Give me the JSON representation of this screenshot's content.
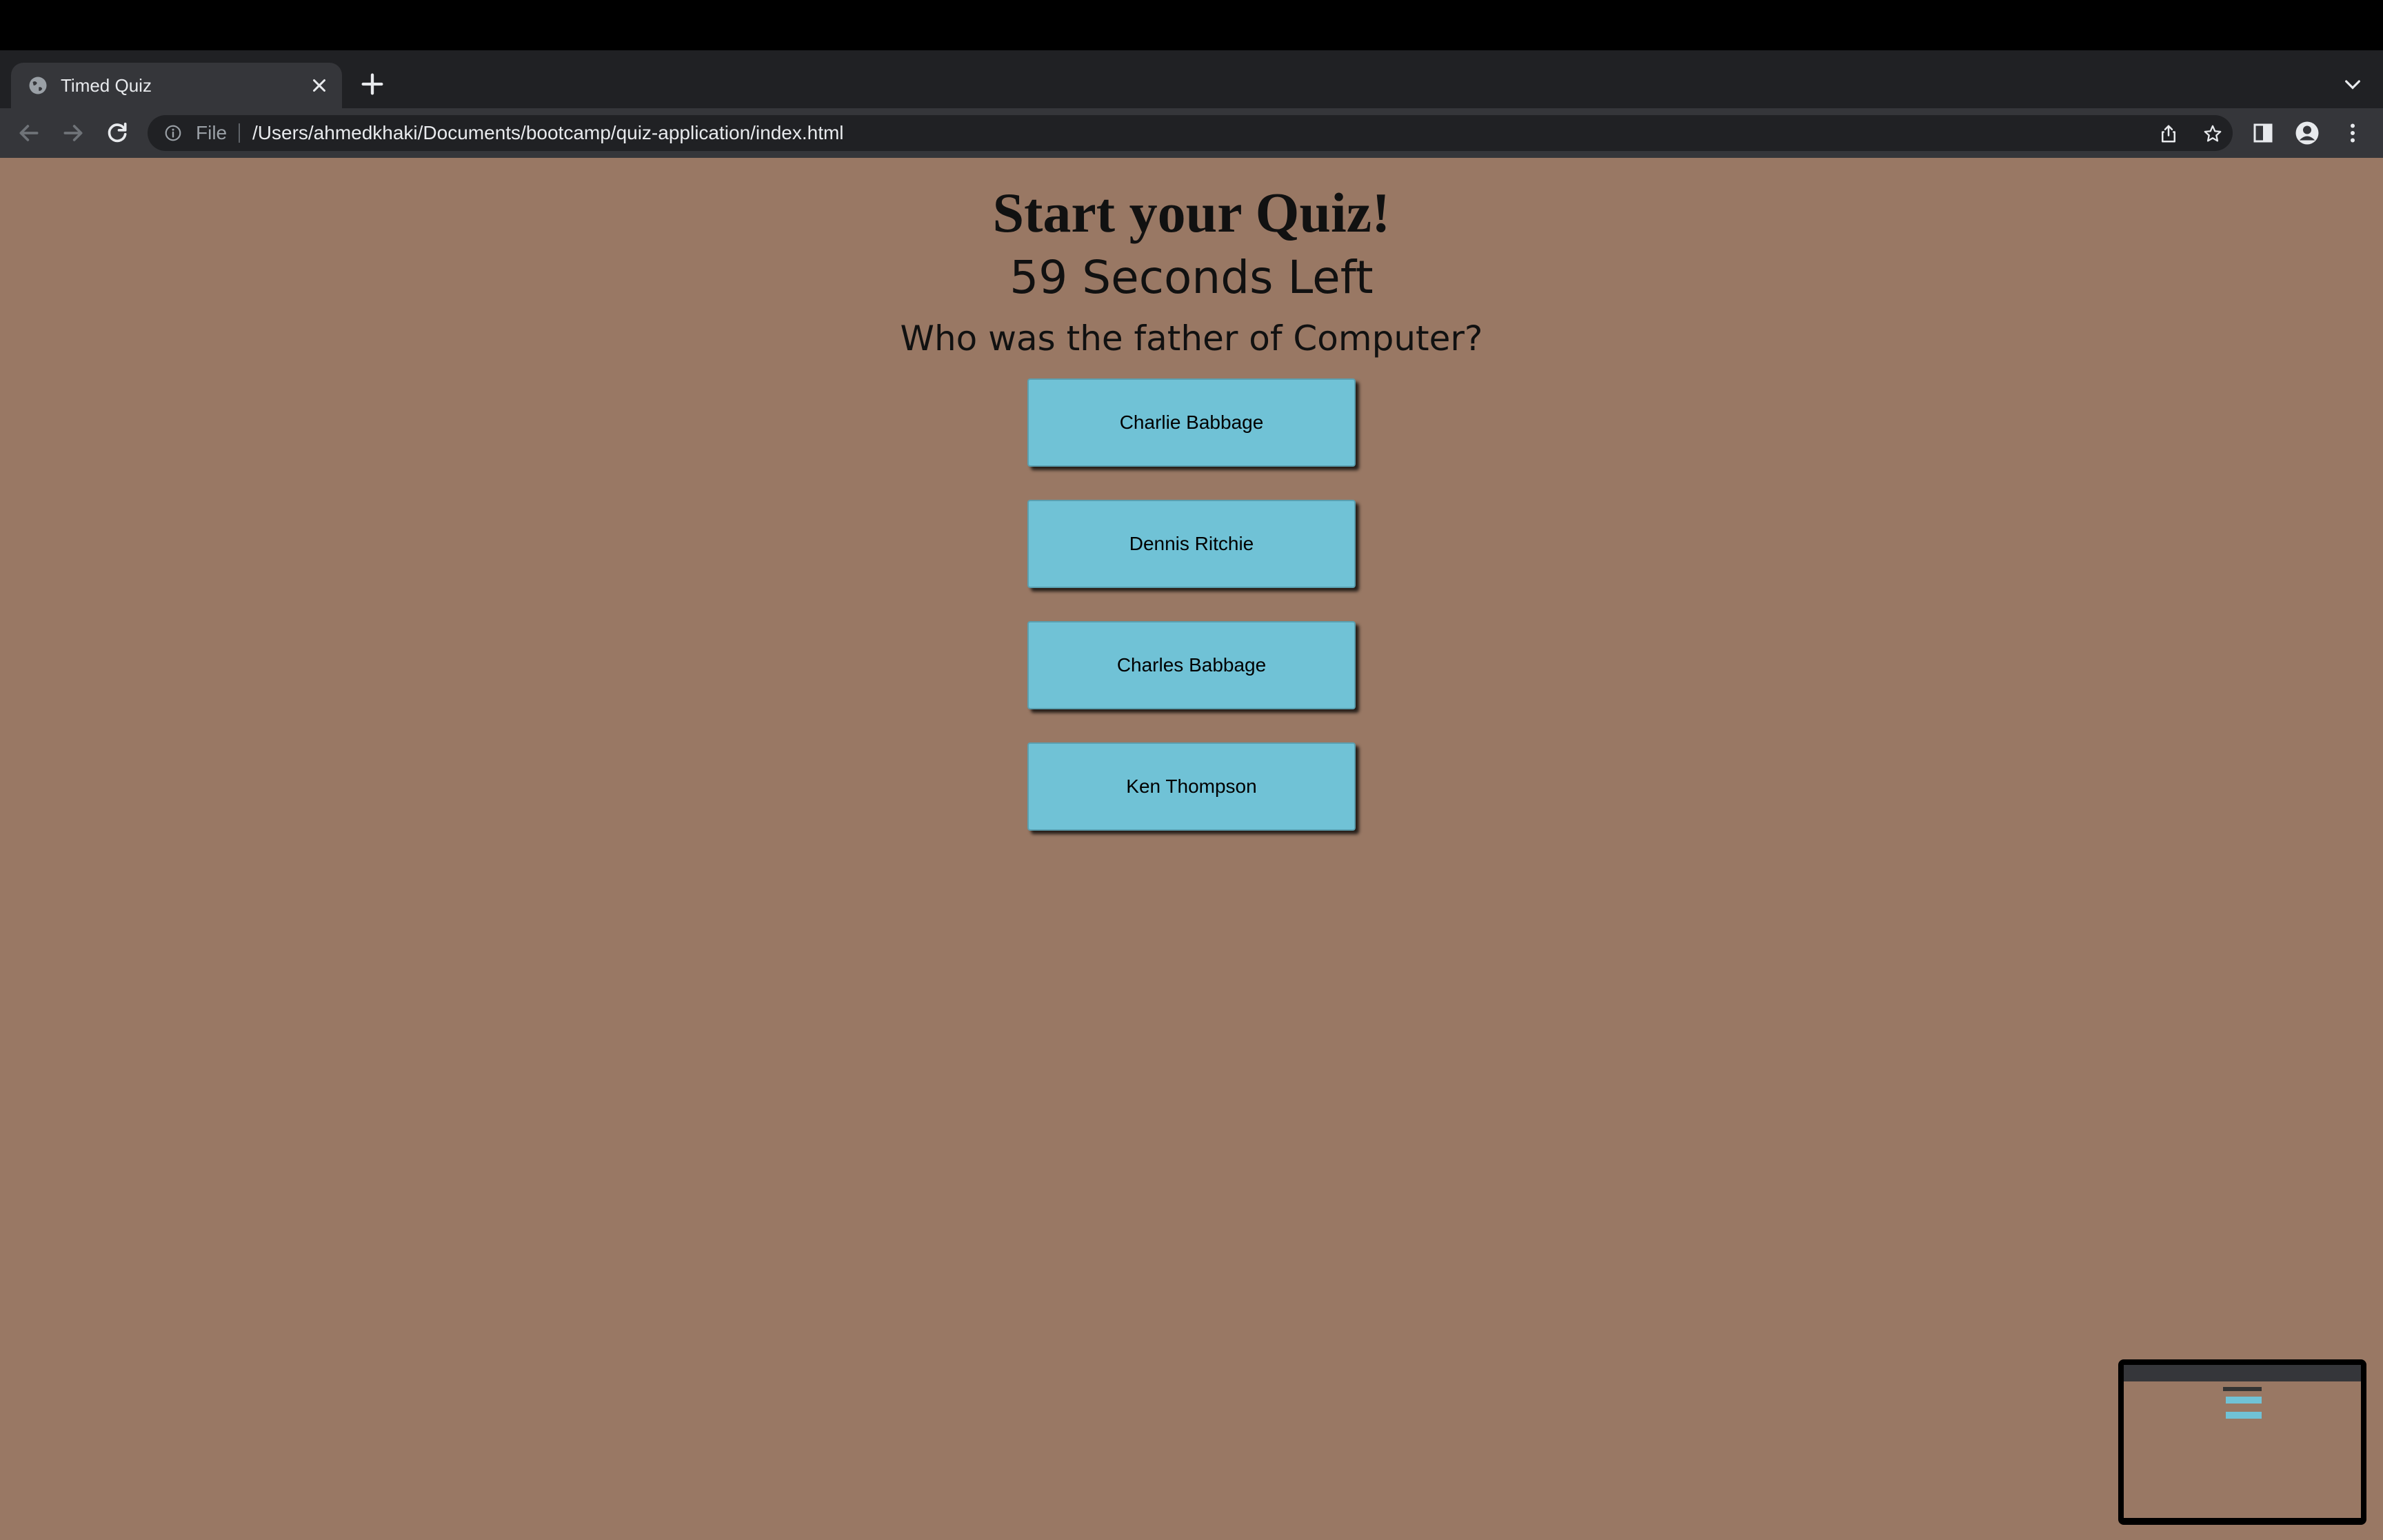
{
  "browser": {
    "tab_title": "Timed Quiz",
    "address_scheme_label": "File",
    "url": "/Users/ahmedkhaki/Documents/bootcamp/quiz-application/index.html"
  },
  "quiz": {
    "title": "Start your Quiz!",
    "timer_text": "59 Seconds Left",
    "question": "Who was the father of Computer?",
    "answers": [
      "Charlie Babbage",
      "Dennis Ritchie",
      "Charles Babbage",
      "Ken Thompson"
    ]
  },
  "colors": {
    "page_background": "#997864",
    "answer_button": "#70c2d6",
    "tabstrip": "#202124",
    "toolbar": "#35363a"
  },
  "icons": {
    "tab_favicon": "globe-icon",
    "tab_close": "close-icon",
    "new_tab": "plus-icon",
    "tab_search": "chevron-down-icon",
    "back": "back-arrow-icon",
    "forward": "forward-arrow-icon",
    "reload": "reload-icon",
    "site_info": "info-icon",
    "share": "share-icon",
    "bookmark": "star-icon",
    "side_panel": "side-panel-icon",
    "profile": "profile-icon",
    "menu": "kebab-menu-icon"
  }
}
